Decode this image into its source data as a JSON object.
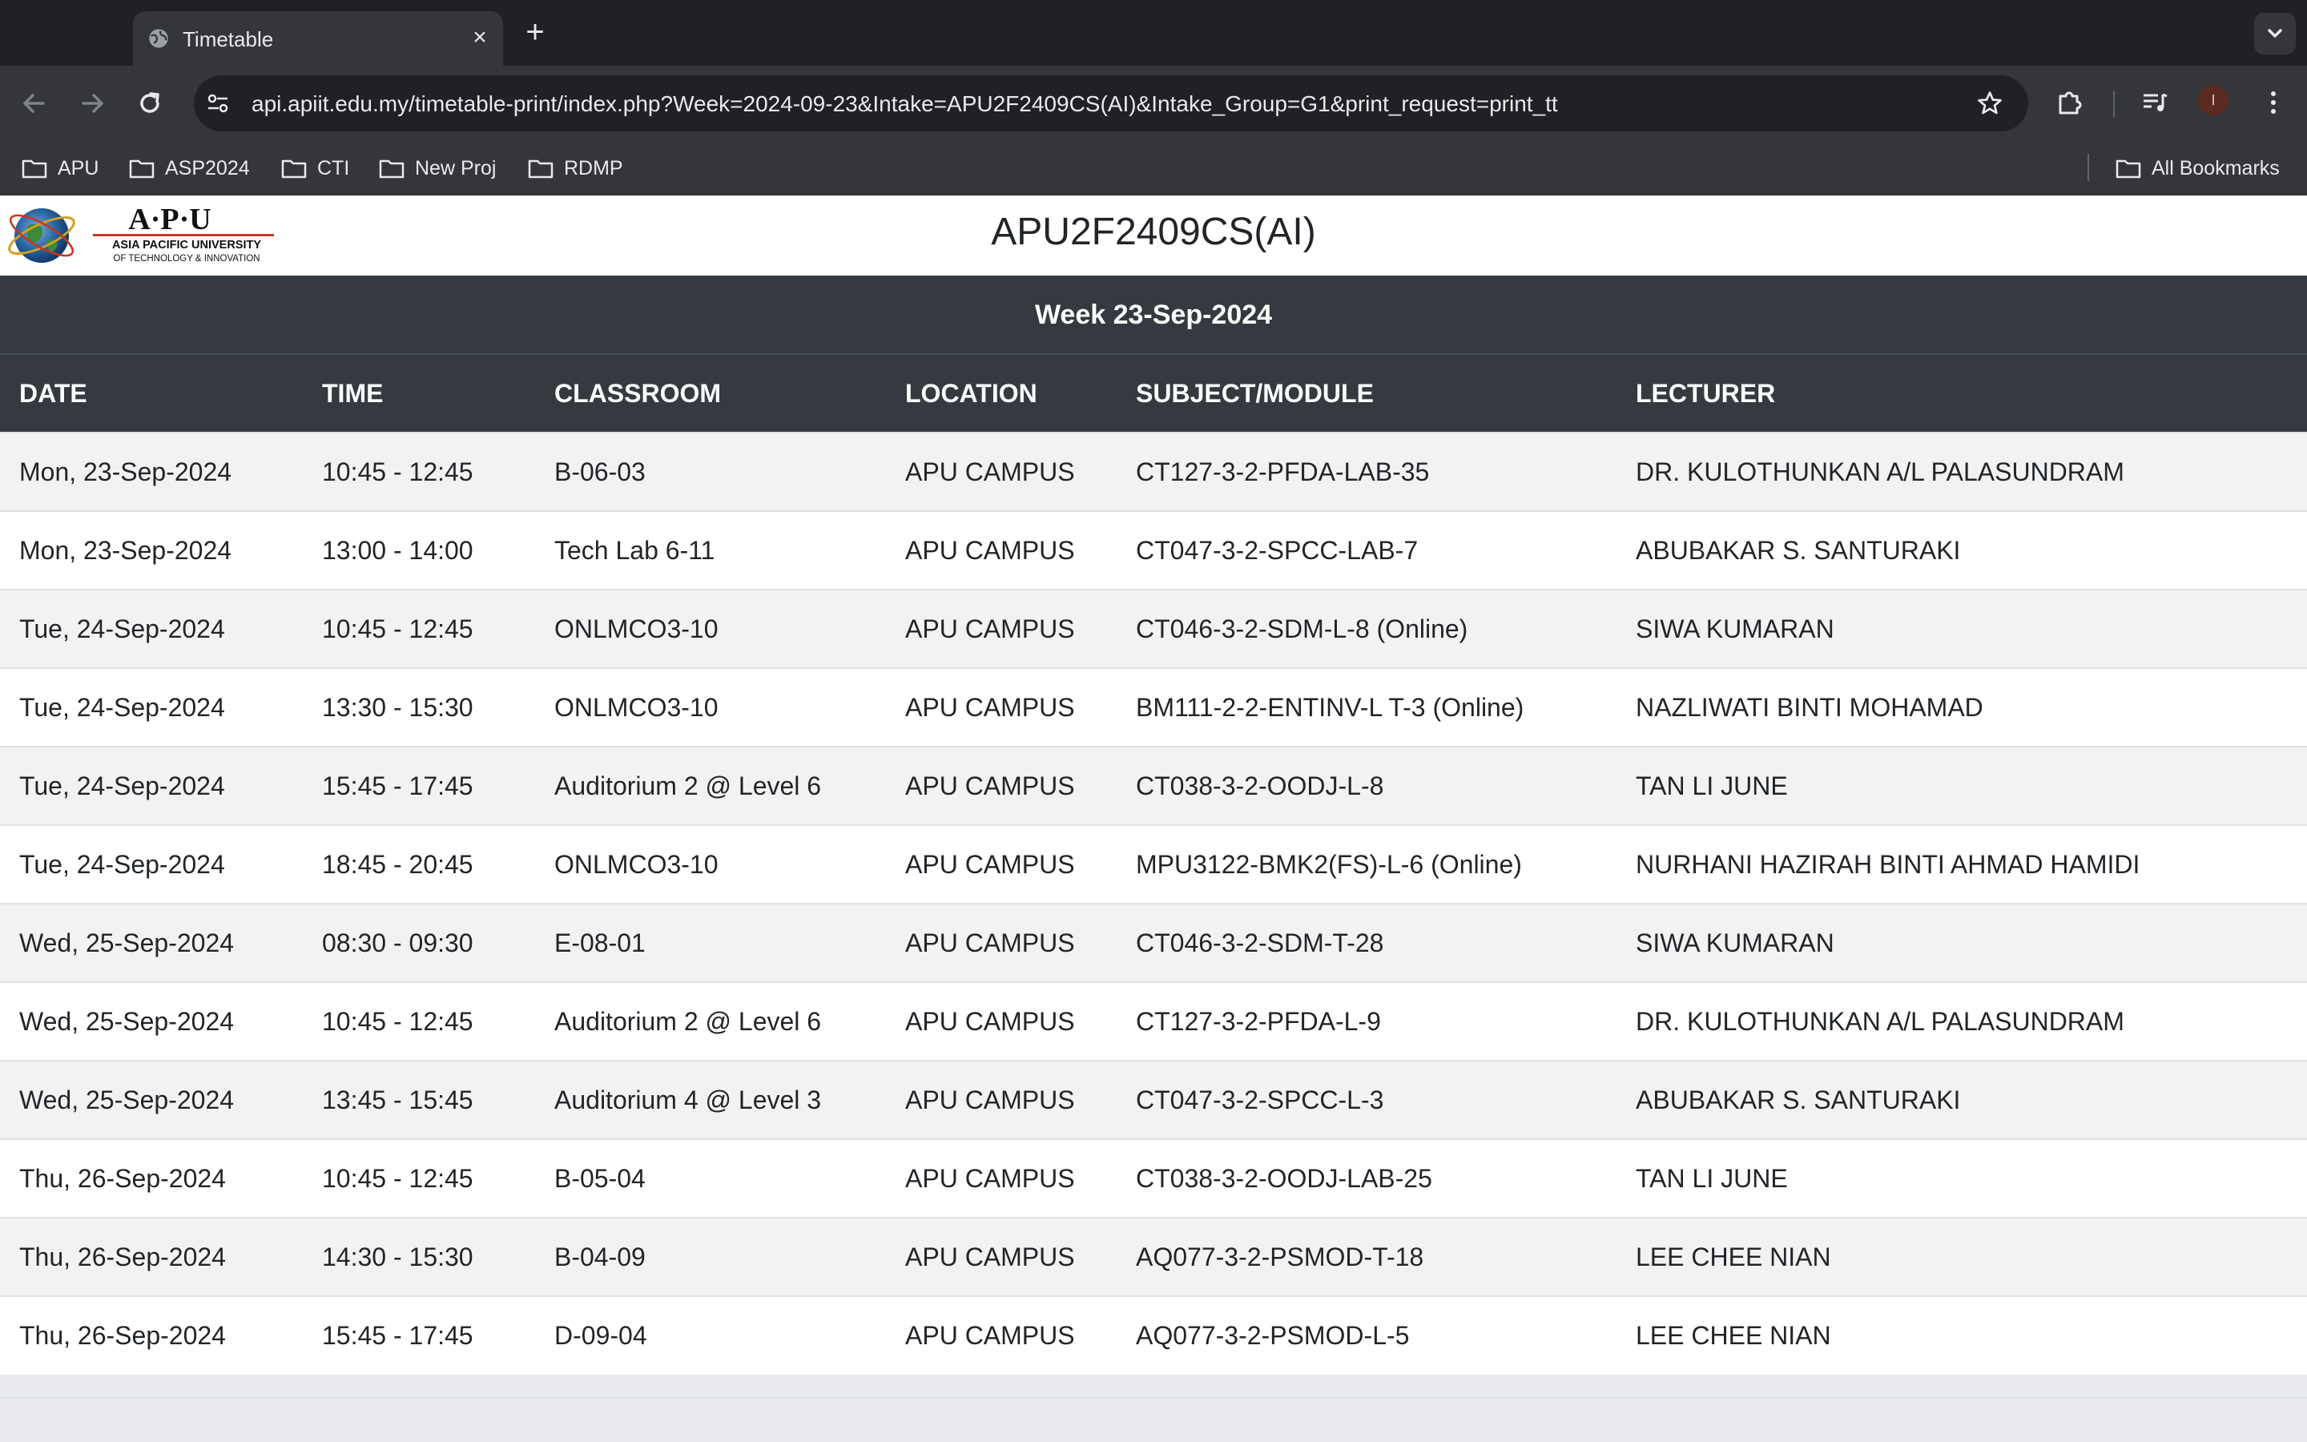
{
  "browser": {
    "tab_title": "Timetable",
    "url": "api.apiit.edu.my/timetable-print/index.php?Week=2024-09-23&Intake=APU2F2409CS(AI)&Intake_Group=G1&print_request=print_tt",
    "avatar_letter": "I",
    "bookmarks": [
      "APU",
      "ASP2024",
      "CTI",
      "New Proj",
      "RDMP"
    ],
    "all_bookmarks_label": "All Bookmarks"
  },
  "page": {
    "logo_text": "A·P·U",
    "logo_subtitle_1": "ASIA PACIFIC UNIVERSITY",
    "logo_subtitle_2": "OF TECHNOLOGY & INNOVATION",
    "intake": "APU2F2409CS(AI)",
    "week_label": "Week 23-Sep-2024",
    "columns": [
      "DATE",
      "TIME",
      "CLASSROOM",
      "LOCATION",
      "SUBJECT/MODULE",
      "LECTURER"
    ],
    "rows": [
      [
        "Mon, 23-Sep-2024",
        "10:45 - 12:45",
        "B-06-03",
        "APU CAMPUS",
        "CT127-3-2-PFDA-LAB-35",
        "DR. KULOTHUNKAN A/L PALASUNDRAM"
      ],
      [
        "Mon, 23-Sep-2024",
        "13:00 - 14:00",
        "Tech Lab 6-11",
        "APU CAMPUS",
        "CT047-3-2-SPCC-LAB-7",
        "ABUBAKAR S. SANTURAKI"
      ],
      [
        "Tue, 24-Sep-2024",
        "10:45 - 12:45",
        "ONLMCO3-10",
        "APU CAMPUS",
        "CT046-3-2-SDM-L-8 (Online)",
        "SIWA KUMARAN"
      ],
      [
        "Tue, 24-Sep-2024",
        "13:30 - 15:30",
        "ONLMCO3-10",
        "APU CAMPUS",
        "BM111-2-2-ENTINV-L T-3 (Online)",
        "NAZLIWATI BINTI MOHAMAD"
      ],
      [
        "Tue, 24-Sep-2024",
        "15:45 - 17:45",
        "Auditorium 2 @ Level 6",
        "APU CAMPUS",
        "CT038-3-2-OODJ-L-8",
        "TAN LI JUNE"
      ],
      [
        "Tue, 24-Sep-2024",
        "18:45 - 20:45",
        "ONLMCO3-10",
        "APU CAMPUS",
        "MPU3122-BMK2(FS)-L-6 (Online)",
        "NURHANI HAZIRAH BINTI AHMAD HAMIDI"
      ],
      [
        "Wed, 25-Sep-2024",
        "08:30 - 09:30",
        "E-08-01",
        "APU CAMPUS",
        "CT046-3-2-SDM-T-28",
        "SIWA KUMARAN"
      ],
      [
        "Wed, 25-Sep-2024",
        "10:45 - 12:45",
        "Auditorium 2 @ Level 6",
        "APU CAMPUS",
        "CT127-3-2-PFDA-L-9",
        "DR. KULOTHUNKAN A/L PALASUNDRAM"
      ],
      [
        "Wed, 25-Sep-2024",
        "13:45 - 15:45",
        "Auditorium 4 @ Level 3",
        "APU CAMPUS",
        "CT047-3-2-SPCC-L-3",
        "ABUBAKAR S. SANTURAKI"
      ],
      [
        "Thu, 26-Sep-2024",
        "10:45 - 12:45",
        "B-05-04",
        "APU CAMPUS",
        "CT038-3-2-OODJ-LAB-25",
        "TAN LI JUNE"
      ],
      [
        "Thu, 26-Sep-2024",
        "14:30 - 15:30",
        "B-04-09",
        "APU CAMPUS",
        "AQ077-3-2-PSMOD-T-18",
        "LEE CHEE NIAN"
      ],
      [
        "Thu, 26-Sep-2024",
        "15:45 - 17:45",
        "D-09-04",
        "APU CAMPUS",
        "AQ077-3-2-PSMOD-L-5",
        "LEE CHEE NIAN"
      ]
    ]
  }
}
